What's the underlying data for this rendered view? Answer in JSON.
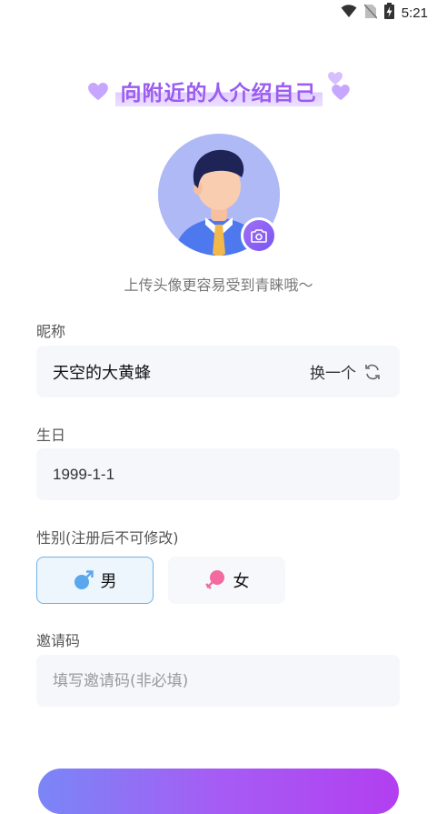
{
  "status_bar": {
    "time": "5:21",
    "icons": [
      "wifi-icon",
      "no-sim-icon",
      "battery-charging-icon"
    ]
  },
  "header": {
    "title": "向附近的人介绍自己"
  },
  "avatar": {
    "hint": "上传头像更容易受到青睐哦～",
    "camera_icon": "camera-icon"
  },
  "form": {
    "nickname": {
      "label": "昵称",
      "value": "天空的大黄蜂",
      "change_label": "换一个",
      "change_icon": "refresh-icon"
    },
    "birthday": {
      "label": "生日",
      "value": "1999-1-1"
    },
    "gender": {
      "label": "性别(注册后不可修改)",
      "options": [
        {
          "label": "男",
          "icon": "male-icon",
          "color": "#5aa7ee",
          "selected": true
        },
        {
          "label": "女",
          "icon": "female-icon",
          "color": "#f26aa0",
          "selected": false
        }
      ]
    },
    "invite": {
      "label": "邀请码",
      "value": "",
      "placeholder": "填写邀请码(非必填)"
    }
  },
  "colors": {
    "accent_purple": "#9b5cf0",
    "selected_border": "#6cb3ea",
    "field_bg": "#f6f7fb"
  }
}
